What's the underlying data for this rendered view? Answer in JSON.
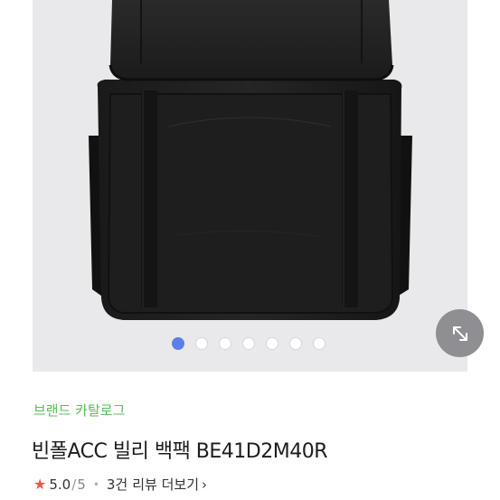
{
  "gallery": {
    "page_count": 7,
    "active_index": 0,
    "colors": {
      "background": "#e9e8eb",
      "active_dot": "#5b7fe6",
      "zoom_button": "#8f8f93"
    },
    "zoom_icon": "expand-arrows-icon"
  },
  "product": {
    "brand_catalog_label": "브랜드 카탈로그",
    "title": "빈폴ACC 빌리 백팩 BE41D2M40R",
    "rating": {
      "star_icon": "star-icon",
      "value": "5.0",
      "separator": "/",
      "max": "5",
      "middle_dot": "•"
    },
    "reviews": {
      "count_label": "3건",
      "more_label": "리뷰 더보기",
      "chevron": "›"
    },
    "colors": {
      "brand_link": "#5dbb5a",
      "star": "#e95a4c"
    }
  }
}
